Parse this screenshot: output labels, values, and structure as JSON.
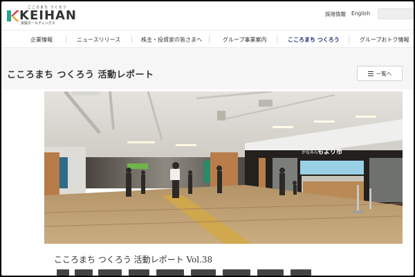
{
  "header": {
    "logo_kana": "こころまち つくろう",
    "logo_text": "KEIHAN",
    "logo_sub": "京阪ホールディングス",
    "util": {
      "recruit": "採用情報",
      "english": "English"
    }
  },
  "nav": {
    "items": [
      {
        "label": "企業情報",
        "active": false
      },
      {
        "label": "ニュースリリース",
        "active": false
      },
      {
        "label": "株主・投資家の皆さまへ",
        "active": false
      },
      {
        "label": "グループ事業案内",
        "active": false
      },
      {
        "label": "こころまち つくろう",
        "active": true
      },
      {
        "label": "グループおトク情報",
        "active": false
      }
    ]
  },
  "page": {
    "title": "こころまち つくろう 活動レポート",
    "list_button": "一覧へ"
  },
  "hero": {
    "store_kana": "かなみん",
    "store_sign": "もより市"
  },
  "article": {
    "vol_title": "こころまち つくろう 活動レポート Vol.38"
  },
  "colors": {
    "brand_navy": "#1d2a6b",
    "logo_green": "#2aa58c",
    "logo_red": "#d8343b",
    "logo_orange": "#f0a02c"
  }
}
